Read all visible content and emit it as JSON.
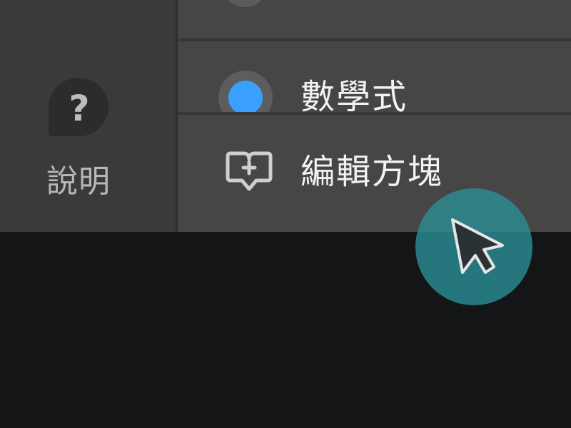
{
  "sidebar": {
    "help": {
      "label": "說明",
      "icon": "help-bubble-icon"
    }
  },
  "menu": {
    "items": [
      {
        "label": "",
        "icon": "radio-icon"
      },
      {
        "label": "數學式",
        "icon": "radio-selected-icon",
        "selected": true
      },
      {
        "label": "編輯方塊",
        "icon": "add-block-icon"
      }
    ]
  },
  "cursor": {
    "icon": "pointer-cursor-icon"
  },
  "colors": {
    "background": "#131517",
    "panel": "#464646",
    "rail": "#3a3a3a",
    "accent_blue": "#3aa0ff",
    "cursor_teal": "#2b8c94"
  }
}
